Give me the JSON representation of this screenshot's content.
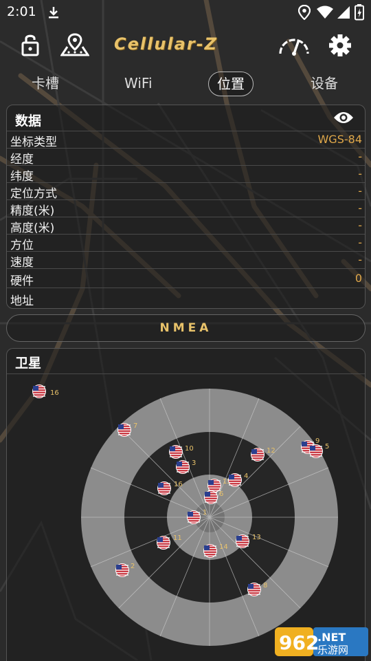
{
  "status_bar": {
    "time": "2:01",
    "icons": [
      "download-icon",
      "location-icon",
      "wifi-icon",
      "cellular-signal-icon",
      "battery-icon"
    ]
  },
  "app_bar": {
    "logo_text": "Cellular-Z",
    "icons": [
      "lock-open-icon",
      "map-pin-icon",
      "speedometer-icon",
      "gear-icon"
    ],
    "accent_color": "#e8c26a"
  },
  "tabs": [
    {
      "label": "卡槽",
      "active": false
    },
    {
      "label": "WiFi",
      "active": false
    },
    {
      "label": "位置",
      "active": true
    },
    {
      "label": "设备",
      "active": false
    }
  ],
  "data_panel": {
    "title": "数据",
    "rows": [
      {
        "key": "坐标类型",
        "value": "WGS-84"
      },
      {
        "key": "经度",
        "value": "-"
      },
      {
        "key": "纬度",
        "value": "-"
      },
      {
        "key": "定位方式",
        "value": "-"
      },
      {
        "key": "精度(米)",
        "value": "-"
      },
      {
        "key": "高度(米)",
        "value": "-"
      },
      {
        "key": "方位",
        "value": "-"
      },
      {
        "key": "速度",
        "value": "-"
      },
      {
        "key": "硬件",
        "value": "0"
      },
      {
        "key": "地址",
        "value": ""
      }
    ]
  },
  "nmea_button": {
    "label": "NMEA"
  },
  "satellite_panel": {
    "title": "卫星",
    "satellites": [
      {
        "id": "16",
        "flag": "us-flag"
      },
      {
        "id": "7",
        "flag": "us-flag"
      },
      {
        "id": "10",
        "flag": "us-flag"
      },
      {
        "id": "3",
        "flag": "us-flag"
      },
      {
        "id": "12",
        "flag": "us-flag"
      },
      {
        "id": "9",
        "flag": "us-flag"
      },
      {
        "id": "5",
        "flag": "us-flag"
      },
      {
        "id": "16",
        "flag": "us-flag"
      },
      {
        "id": "15",
        "flag": "us-flag"
      },
      {
        "id": "4",
        "flag": "us-flag"
      },
      {
        "id": "6",
        "flag": "us-flag"
      },
      {
        "id": "1",
        "flag": "us-flag"
      },
      {
        "id": "11",
        "flag": "us-flag"
      },
      {
        "id": "13",
        "flag": "us-flag"
      },
      {
        "id": "14",
        "flag": "us-flag"
      },
      {
        "id": "2",
        "flag": "us-flag"
      },
      {
        "id": "8",
        "flag": "us-flag"
      }
    ]
  },
  "watermark": {
    "line1": "962.NET",
    "line2": "乐游网"
  }
}
